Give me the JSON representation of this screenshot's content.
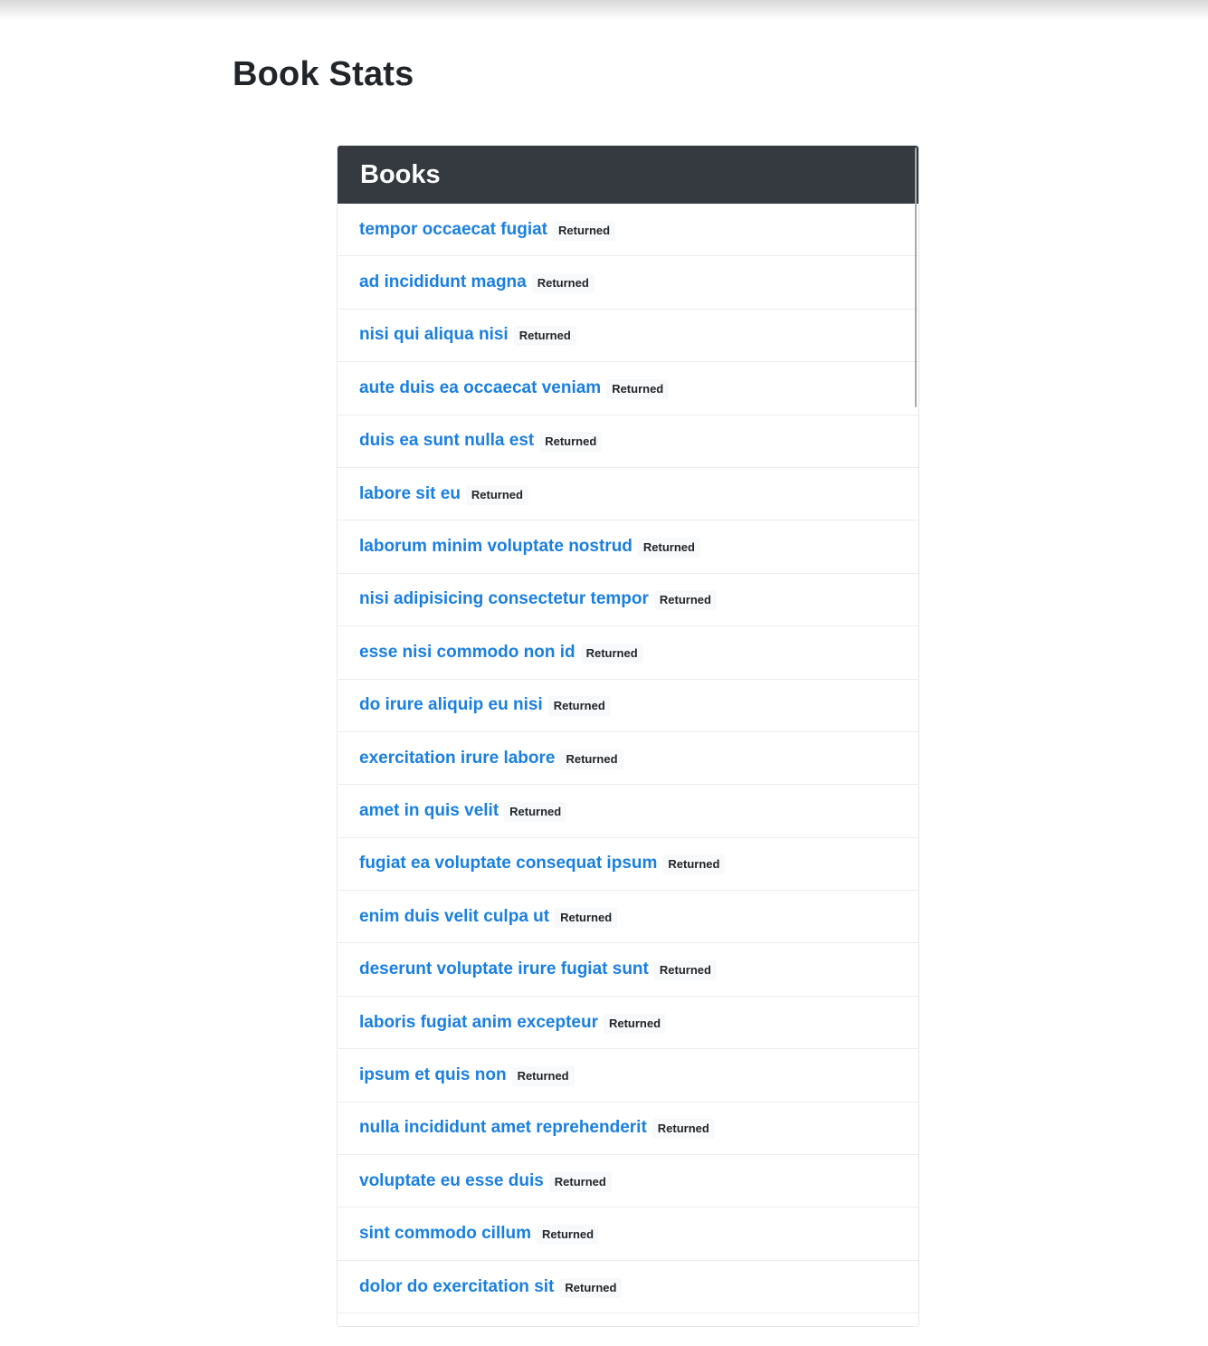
{
  "page": {
    "title": "Book Stats"
  },
  "card": {
    "header": "Books",
    "items": [
      {
        "title": "tempor occaecat fugiat",
        "status": "Returned"
      },
      {
        "title": "ad incididunt magna",
        "status": "Returned"
      },
      {
        "title": "nisi qui aliqua nisi",
        "status": "Returned"
      },
      {
        "title": "aute duis ea occaecat veniam",
        "status": "Returned"
      },
      {
        "title": "duis ea sunt nulla est",
        "status": "Returned"
      },
      {
        "title": "labore sit eu",
        "status": "Returned"
      },
      {
        "title": "laborum minim voluptate nostrud",
        "status": "Returned"
      },
      {
        "title": "nisi adipisicing consectetur tempor",
        "status": "Returned"
      },
      {
        "title": "esse nisi commodo non id",
        "status": "Returned"
      },
      {
        "title": "do irure aliquip eu nisi",
        "status": "Returned"
      },
      {
        "title": "exercitation irure labore",
        "status": "Returned"
      },
      {
        "title": "amet in quis velit",
        "status": "Returned"
      },
      {
        "title": "fugiat ea voluptate consequat ipsum",
        "status": "Returned"
      },
      {
        "title": "enim duis velit culpa ut",
        "status": "Returned"
      },
      {
        "title": "deserunt voluptate irure fugiat sunt",
        "status": "Returned"
      },
      {
        "title": "laboris fugiat anim excepteur",
        "status": "Returned"
      },
      {
        "title": "ipsum et quis non",
        "status": "Returned"
      },
      {
        "title": "nulla incididunt amet reprehenderit",
        "status": "Returned"
      },
      {
        "title": "voluptate eu esse duis",
        "status": "Returned"
      },
      {
        "title": "sint commodo cillum",
        "status": "Returned"
      },
      {
        "title": "dolor do exercitation sit",
        "status": "Returned"
      }
    ]
  },
  "colors": {
    "header_bg": "#343a40",
    "link": "#1a7fe0",
    "badge_bg": "#f8f9fa"
  }
}
